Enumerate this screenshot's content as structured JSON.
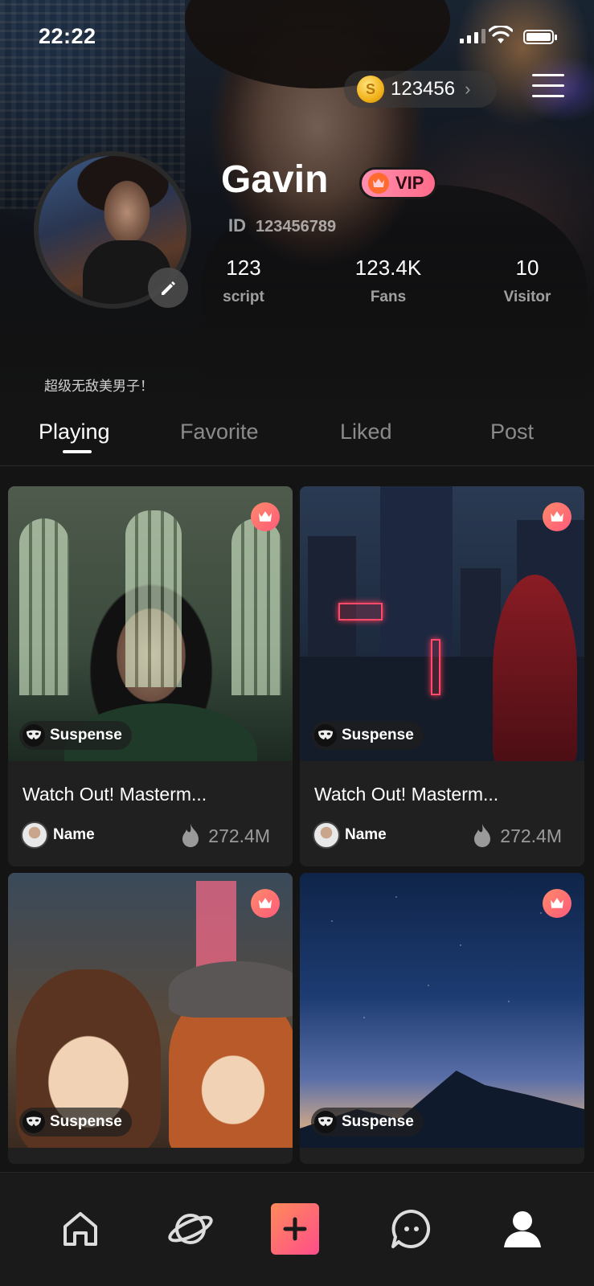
{
  "status_bar": {
    "time": "22:22"
  },
  "header": {
    "coins": "123456",
    "coin_symbol": "S"
  },
  "profile": {
    "name": "Gavin",
    "vip_label": "VIP",
    "id_label": "ID",
    "id_value": "123456789",
    "bio": "超级无敌美男子！",
    "stats": [
      {
        "value": "123",
        "label": "script"
      },
      {
        "value": "123.4K",
        "label": "Fans"
      },
      {
        "value": "10",
        "label": "Visitor"
      }
    ]
  },
  "tabs": [
    {
      "label": "Playing",
      "active": true
    },
    {
      "label": "Favorite",
      "active": false
    },
    {
      "label": "Liked",
      "active": false
    },
    {
      "label": "Post",
      "active": false
    }
  ],
  "cards": [
    {
      "genre": "Suspense",
      "title": "Watch Out! Masterm...",
      "author": "Name",
      "heat": "272.4M"
    },
    {
      "genre": "Suspense",
      "title": "Watch Out! Masterm...",
      "author": "Name",
      "heat": "272.4M"
    },
    {
      "genre": "Suspense",
      "title": "",
      "author": "",
      "heat": ""
    },
    {
      "genre": "Suspense",
      "title": "",
      "author": "",
      "heat": ""
    }
  ],
  "nav": [
    {
      "icon": "home-icon"
    },
    {
      "icon": "planet-icon"
    },
    {
      "icon": "plus-icon"
    },
    {
      "icon": "chat-icon"
    },
    {
      "icon": "profile-icon",
      "active": true
    }
  ],
  "colors": {
    "accent_gradient_start": "#ff8a5a",
    "accent_gradient_end": "#ff4d8a",
    "vip": "#ff7a9a",
    "coin": "#f2b21a"
  }
}
